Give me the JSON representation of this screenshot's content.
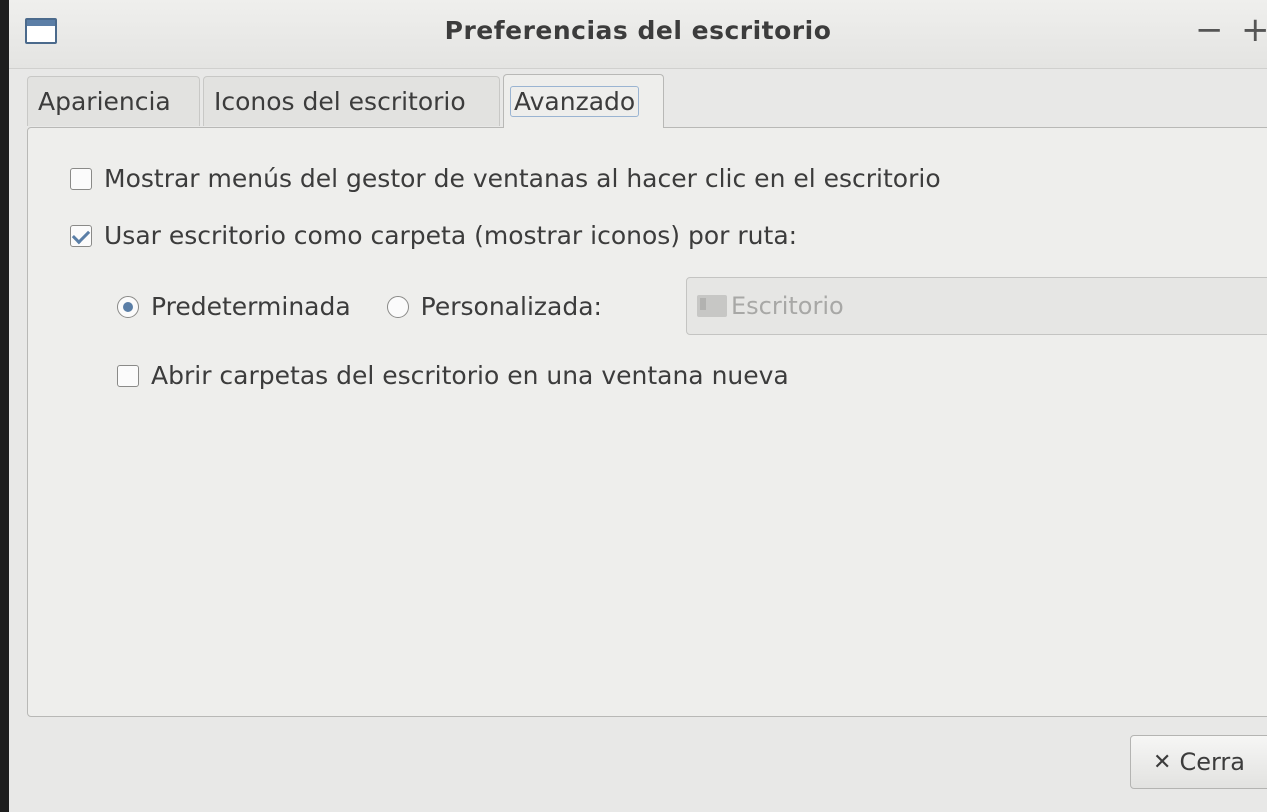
{
  "window": {
    "title": "Preferencias del escritorio",
    "minimize_label": "−",
    "maximize_label": "+"
  },
  "tabs": [
    {
      "label": "Apariencia"
    },
    {
      "label": "Iconos del escritorio"
    },
    {
      "label": "Avanzado",
      "selected": true
    }
  ],
  "options": {
    "show_wm_menu": {
      "label": "Mostrar menús del gestor de ventanas al hacer clic en el escritorio",
      "checked": false
    },
    "use_desktop_folder": {
      "label": "Usar escritorio como carpeta (mostrar iconos) por ruta:",
      "checked": true
    },
    "path_default": {
      "label": "Predeterminada",
      "selected": true
    },
    "path_custom": {
      "label": "Personalizada:",
      "selected": false
    },
    "folder_value": "Escritorio",
    "open_new_window": {
      "label": "Abrir carpetas del escritorio en una ventana nueva",
      "checked": false
    }
  },
  "footer": {
    "close_label": "Cerra"
  },
  "colors": {
    "accent": "#5a7ea6",
    "background": "#eeeeec"
  },
  "icons": {
    "window": "window-icon",
    "folder": "folder-icon",
    "close": "close-icon"
  }
}
